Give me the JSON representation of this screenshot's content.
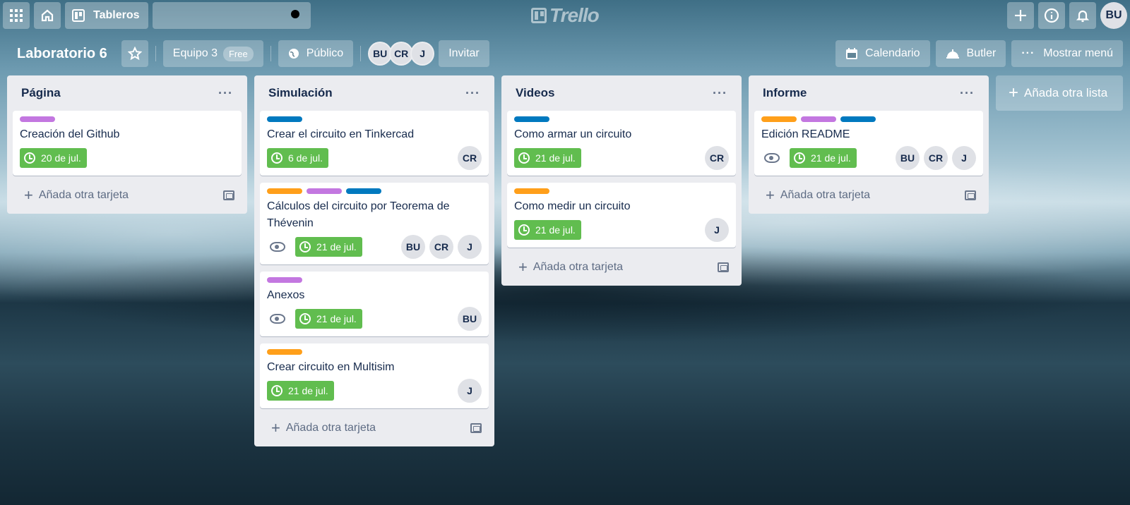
{
  "topbar": {
    "boards_label": "Tableros",
    "logo_text": "Trello",
    "user_initials": "BU"
  },
  "board": {
    "title": "Laboratorio 6",
    "team": "Equipo 3",
    "team_plan": "Free",
    "visibility": "Público",
    "members": [
      "BU",
      "CR",
      "J"
    ],
    "invite_label": "Invitar",
    "calendar_label": "Calendario",
    "butler_label": "Butler",
    "menu_label": "Mostrar menú"
  },
  "colors": {
    "label_purple": "#c377e0",
    "label_blue": "#0079bf",
    "label_orange": "#ff9f1a",
    "due_green": "#61bd4f"
  },
  "add_card_label": "Añada otra tarjeta",
  "add_list_label": "Añada otra lista",
  "lists": [
    {
      "title": "Página",
      "cards": [
        {
          "title": "Creación del Github",
          "labels": [
            "purple"
          ],
          "due": "20 de jul.",
          "watch": false,
          "members": []
        }
      ]
    },
    {
      "title": "Simulación",
      "cards": [
        {
          "title": "Crear el circuito en Tinkercad",
          "labels": [
            "blue"
          ],
          "due": "6 de jul.",
          "watch": false,
          "members": [
            "CR"
          ]
        },
        {
          "title": "Cálculos del circuito por Teorema de Thévenin",
          "labels": [
            "orange",
            "purple",
            "blue"
          ],
          "due": "21 de jul.",
          "watch": true,
          "members": [
            "BU",
            "CR",
            "J"
          ]
        },
        {
          "title": "Anexos",
          "labels": [
            "purple"
          ],
          "due": "21 de jul.",
          "watch": true,
          "members": [
            "BU"
          ]
        },
        {
          "title": "Crear circuito en Multisim",
          "labels": [
            "orange"
          ],
          "due": "21 de jul.",
          "watch": false,
          "members": [
            "J"
          ]
        }
      ]
    },
    {
      "title": "Videos",
      "cards": [
        {
          "title": "Como armar un circuito",
          "labels": [
            "blue"
          ],
          "due": "21 de jul.",
          "watch": false,
          "members": [
            "CR"
          ]
        },
        {
          "title": "Como medir un circuito",
          "labels": [
            "orange"
          ],
          "due": "21 de jul.",
          "watch": false,
          "members": [
            "J"
          ]
        }
      ]
    },
    {
      "title": "Informe",
      "cards": [
        {
          "title": "Edición README",
          "labels": [
            "orange",
            "purple",
            "blue"
          ],
          "due": "21 de jul.",
          "watch": true,
          "members": [
            "BU",
            "CR",
            "J"
          ]
        }
      ]
    }
  ]
}
